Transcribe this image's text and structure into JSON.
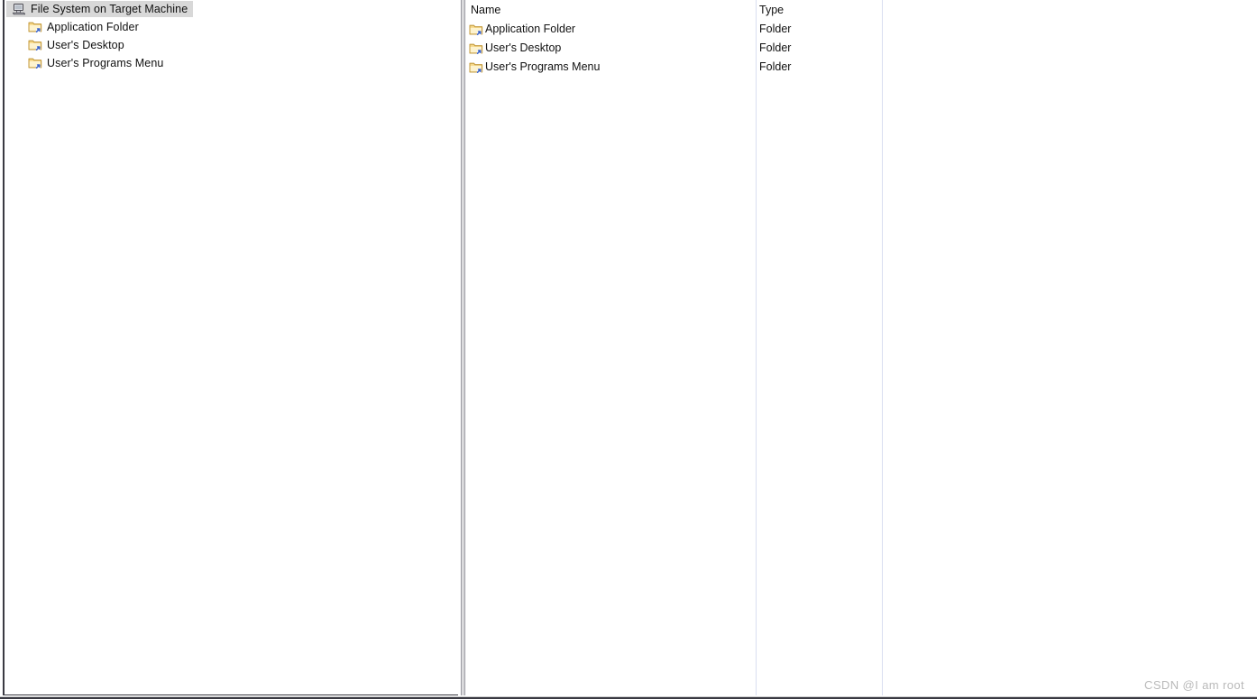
{
  "tree": {
    "root": {
      "label": "File System on Target Machine",
      "icon": "computer-icon",
      "selected": true
    },
    "children": [
      {
        "label": "Application Folder",
        "icon": "folder-shortcut-icon"
      },
      {
        "label": "User's Desktop",
        "icon": "folder-shortcut-icon"
      },
      {
        "label": "User's Programs Menu",
        "icon": "folder-shortcut-icon"
      }
    ]
  },
  "list": {
    "columns": [
      {
        "key": "name",
        "label": "Name"
      },
      {
        "key": "type",
        "label": "Type"
      }
    ],
    "rows": [
      {
        "name": "Application Folder",
        "type": "Folder",
        "icon": "folder-shortcut-icon"
      },
      {
        "name": "User's Desktop",
        "type": "Folder",
        "icon": "folder-shortcut-icon"
      },
      {
        "name": "User's Programs Menu",
        "type": "Folder",
        "icon": "folder-shortcut-icon"
      }
    ]
  },
  "watermark": {
    "text": "CSDN @I am root"
  },
  "colors": {
    "selection": "#d8d8d8",
    "panel_border": "#3a3a42",
    "column_divider": "#d9def0",
    "splitter": "#8c8c94",
    "watermark": "#b9b9b9",
    "text": "#111111",
    "folder_body": "#fbe6a8",
    "folder_edge": "#c49a3c",
    "shortcut_badge": "#3a63c8"
  }
}
